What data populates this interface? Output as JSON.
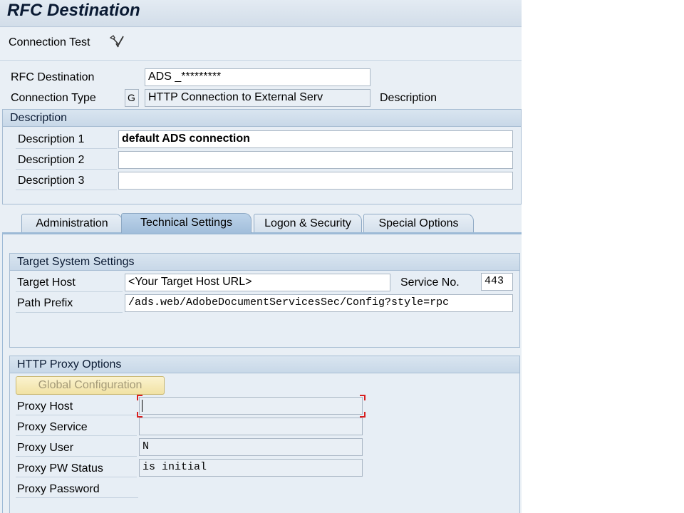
{
  "window": {
    "title": "RFC Destination"
  },
  "toolbar": {
    "connection_test_label": "Connection Test",
    "connection_test_icon": "wrench-check-icon"
  },
  "header_fields": {
    "rfc_destination_label": "RFC Destination",
    "rfc_destination_value": "ADS _*********",
    "connection_type_label": "Connection Type",
    "connection_type_code": "G",
    "connection_type_text": "HTTP Connection to External Serv",
    "description_link": "Description"
  },
  "description_group": {
    "title": "Description",
    "rows": [
      {
        "label": "Description 1",
        "value": "default ADS connection"
      },
      {
        "label": "Description 2",
        "value": ""
      },
      {
        "label": "Description 3",
        "value": ""
      }
    ]
  },
  "tabs": [
    {
      "label": "Administration",
      "active": false
    },
    {
      "label": "Technical Settings",
      "active": true
    },
    {
      "label": "Logon & Security",
      "active": false
    },
    {
      "label": "Special Options",
      "active": false
    }
  ],
  "target_system": {
    "title": "Target System Settings",
    "target_host_label": "Target Host",
    "target_host_value": "<Your Target Host URL>",
    "service_no_label": "Service No.",
    "service_no_value": "443",
    "path_prefix_label": "Path Prefix",
    "path_prefix_value": "/ads.web/AdobeDocumentServicesSec/Config?style=rpc"
  },
  "http_proxy": {
    "title": "HTTP Proxy Options",
    "global_config_button": "Global Configuration",
    "rows": [
      {
        "label": "Proxy Host",
        "value": ""
      },
      {
        "label": "Proxy Service",
        "value": ""
      },
      {
        "label": "Proxy User",
        "value": "N"
      },
      {
        "label": "Proxy PW Status",
        "value": "is initial"
      },
      {
        "label": "Proxy Password",
        "value": ""
      }
    ]
  },
  "colors": {
    "background": "#e9eff5",
    "active_tab": "#a2bedb",
    "focus_marker": "#d81f1f",
    "global_button": "#f1e2a4"
  }
}
